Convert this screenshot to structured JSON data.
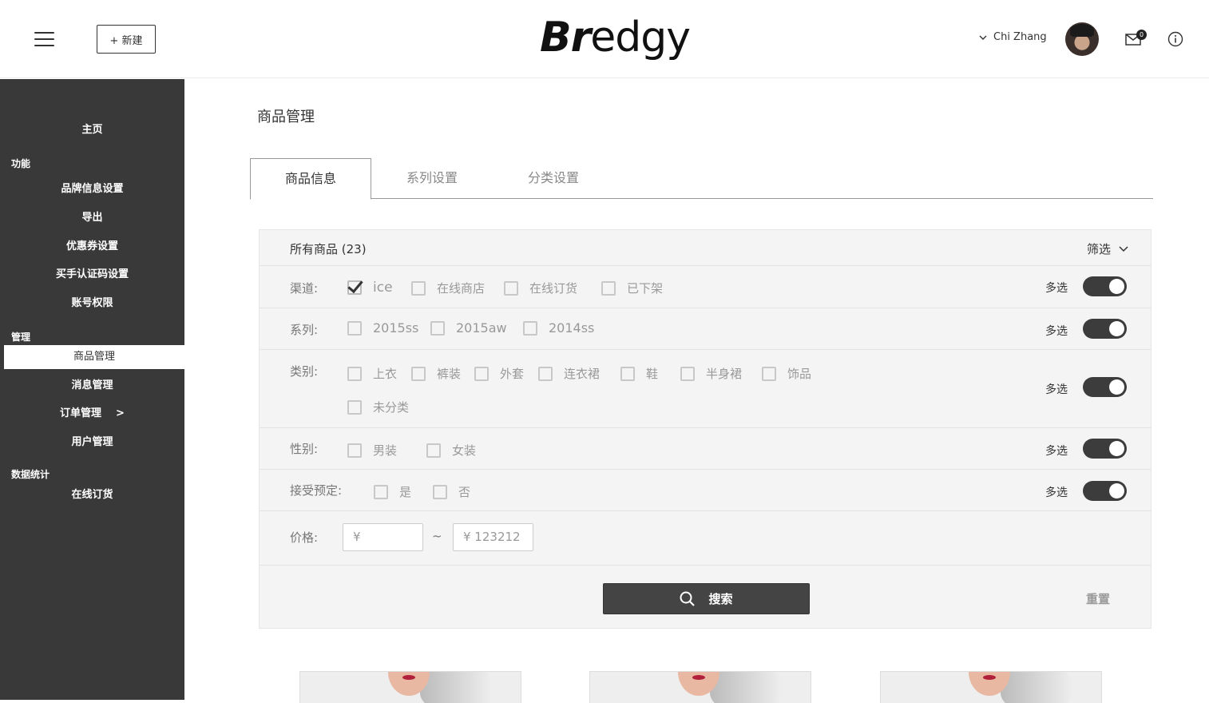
{
  "header": {
    "new_button": "+ 新建",
    "logo_bold": "Br",
    "logo_rest": "edgy",
    "user_name": "Chi Zhang",
    "mail_badge": "0"
  },
  "sidebar": {
    "home": "主页",
    "section_features": "功能",
    "features": [
      "品牌信息设置",
      "导出",
      "优惠券设置",
      "买手认证码设置",
      "账号权限"
    ],
    "section_manage": "管理",
    "manage": [
      "商品管理",
      "消息管理",
      "订单管理",
      "用户管理"
    ],
    "order_chevron": ">",
    "section_stats": "数据统计",
    "stats": [
      "在线订货"
    ]
  },
  "main": {
    "page_title": "商品管理",
    "tabs": [
      "商品信息",
      "系列设置",
      "分类设置"
    ],
    "panel_title": "所有商品 (23)",
    "filter_label": "筛选",
    "multi_label": "多选",
    "rows": {
      "channel": {
        "label": "渠道:",
        "options": [
          "ice",
          "在线商店",
          "在线订货",
          "已下架"
        ],
        "checked": [
          true,
          false,
          false,
          false
        ]
      },
      "series": {
        "label": "系列:",
        "options": [
          "2015ss",
          "2015aw",
          "2014ss"
        ]
      },
      "category": {
        "label": "类别:",
        "options": [
          "上衣",
          "裤装",
          "外套",
          "连衣裙",
          "鞋",
          "半身裙",
          "饰品",
          "未分类"
        ]
      },
      "gender": {
        "label": "性别:",
        "options": [
          "男装",
          "女装"
        ]
      },
      "preorder": {
        "label": "接受预定:",
        "options": [
          "是",
          "否"
        ]
      },
      "price": {
        "label": "价格:",
        "min_value": "¥",
        "tilde": "~",
        "max_value": "¥  123212"
      }
    },
    "search_button": "搜索",
    "reset_button": "重置"
  }
}
